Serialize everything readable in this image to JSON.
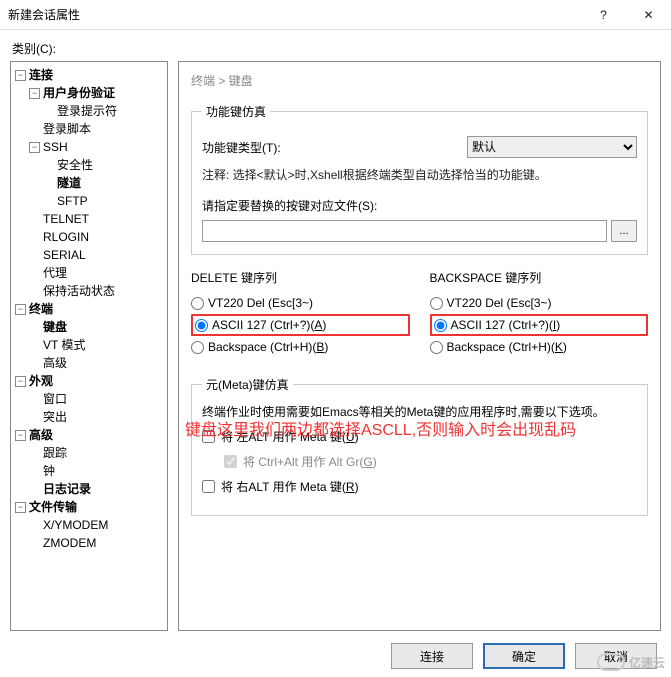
{
  "window": {
    "title": "新建会话属性",
    "help": "?",
    "close": "✕"
  },
  "category_label": "类别(C):",
  "tree": {
    "connection": {
      "label": "连接",
      "auth": "用户身份验证",
      "prompt": "登录提示符",
      "script": "登录脚本",
      "ssh": "SSH",
      "security": "安全性",
      "tunnel": "隧道",
      "sftp": "SFTP",
      "telnet": "TELNET",
      "rlogin": "RLOGIN",
      "serial": "SERIAL",
      "proxy": "代理",
      "keepalive": "保持活动状态"
    },
    "terminal": {
      "label": "终端",
      "keyboard": "键盘",
      "vt": "VT 模式",
      "advanced": "高级"
    },
    "appearance": {
      "label": "外观",
      "window": "窗口",
      "highlight": "突出"
    },
    "advanced": {
      "label": "高级",
      "trace": "跟踪",
      "bell": "钟",
      "log": "日志记录"
    },
    "transfer": {
      "label": "文件传输",
      "xy": "X/YMODEM",
      "z": "ZMODEM"
    }
  },
  "breadcrumb": "终端 > 键盘",
  "funckey": {
    "legend": "功能键仿真",
    "type_label": "功能键类型(T):",
    "type_value": "默认",
    "note": "注释: 选择<默认>时,Xshell根据终端类型自动选择恰当的功能键。",
    "replace_label": "请指定要替换的按键对应文件(S):",
    "path": ""
  },
  "delete": {
    "header": "DELETE 键序列",
    "opt_vt": "VT220 Del (Esc[3~)",
    "opt_ascii": "ASCII 127 (Ctrl+?)(A)",
    "opt_bs": "Backspace (Ctrl+H)(B)"
  },
  "backspace": {
    "header": "BACKSPACE 键序列",
    "opt_vt": "VT220 Del (Esc[3~)",
    "opt_ascii": "ASCII 127 (Ctrl+?)(I)",
    "opt_bs": "Backspace (Ctrl+H)(K)"
  },
  "annot": "键盘这里我们两边都选择ASCLL,否则输入时会出现乱码",
  "meta": {
    "legend": "元(Meta)键仿真",
    "note": "终端作业时使用需要如Emacs等相关的Meta键的应用程序时,需要以下选项。",
    "left": "将 左ALT 用作 Meta 键(U)",
    "ctrlalt": "将 Ctrl+Alt 用作 Alt Gr(G)",
    "right": "将 右ALT 用作 Meta 键(R)"
  },
  "buttons": {
    "connect": "连接",
    "ok": "确定",
    "cancel": "取消"
  },
  "watermark": "亿速云"
}
